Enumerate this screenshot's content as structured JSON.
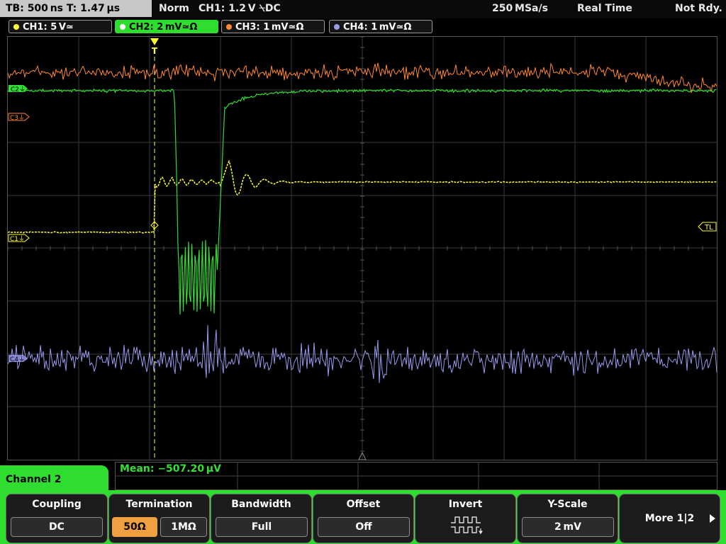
{
  "topbar": {
    "timebase": "TB: 500 ns   T: 1.47 µs",
    "mode": "Norm",
    "trigger": "CH1: 1.2 V ⍀DC",
    "sample_rate": "250 MSa/s",
    "acq_mode": "Real Time",
    "status": "Not Rdy."
  },
  "channels": [
    {
      "label": "CH1: 5 V≃",
      "color": "#ffff33"
    },
    {
      "label": "CH2: 2 mV≃Ω",
      "color": "#33dd33"
    },
    {
      "label": "CH3: 1 mV≃Ω",
      "color": "#ff8833"
    },
    {
      "label": "CH4: 1 mV≃Ω",
      "color": "#9999ee"
    }
  ],
  "markers": {
    "c3": "C3⏚",
    "c1": "C1⏚",
    "c2": "C2⏚",
    "c4": "C4⏚",
    "trigger_level": "TL",
    "trigger_pos": "T"
  },
  "measurement": {
    "text": "Mean: −507.20 µV"
  },
  "menu": {
    "channel": "Channel 2",
    "coupling": {
      "title": "Coupling",
      "value": "DC"
    },
    "termination": {
      "title": "Termination",
      "opt1": "50Ω",
      "opt2": "1MΩ"
    },
    "bandwidth": {
      "title": "Bandwidth",
      "value": "Full"
    },
    "offset": {
      "title": "Offset",
      "value": "Off"
    },
    "invert": {
      "title": "Invert",
      "icon": "invert-square-wave-icon"
    },
    "yscale": {
      "title": "Y-Scale",
      "value": "2 mV"
    },
    "more": "More 1|2"
  }
}
